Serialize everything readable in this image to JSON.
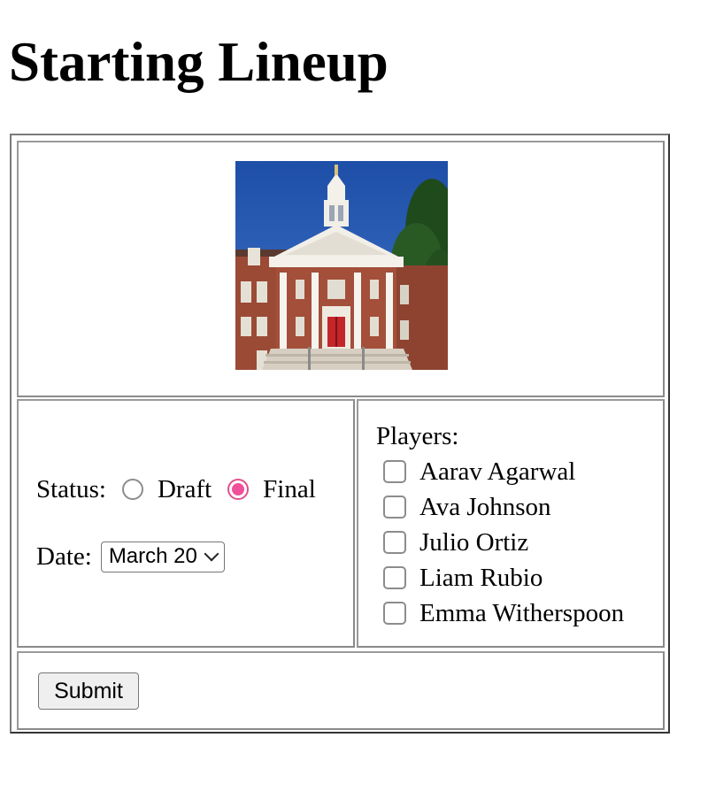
{
  "page": {
    "title": "Starting Lineup"
  },
  "image": {
    "icon": "school-building-photo"
  },
  "form": {
    "status_label": "Status:",
    "status_options": [
      {
        "label": "Draft",
        "checked": false
      },
      {
        "label": "Final",
        "checked": true
      }
    ],
    "date_label": "Date:",
    "date_selected": "March 20"
  },
  "players": {
    "label": "Players:",
    "items": [
      {
        "name": "Aarav Agarwal",
        "checked": false
      },
      {
        "name": "Ava Johnson",
        "checked": false
      },
      {
        "name": "Julio Ortiz",
        "checked": false
      },
      {
        "name": "Liam Rubio",
        "checked": false
      },
      {
        "name": "Emma Witherspoon",
        "checked": false
      }
    ]
  },
  "actions": {
    "submit_label": "Submit"
  },
  "colors": {
    "radio_checked": "#f0509a",
    "border": "#8a8a8a",
    "button_bg": "#efefef"
  }
}
